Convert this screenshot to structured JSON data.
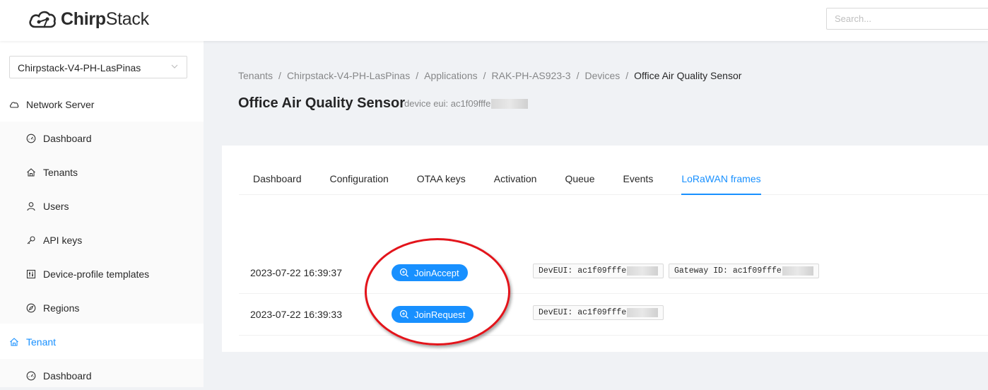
{
  "app": {
    "logo_bold": "Chirp",
    "logo_light": "Stack"
  },
  "search": {
    "placeholder": "Search..."
  },
  "sidebar": {
    "tenant_selector": "Chirpstack-V4-PH-LasPinas",
    "network_server": {
      "label": "Network Server",
      "items": [
        "Dashboard",
        "Tenants",
        "Users",
        "API keys",
        "Device-profile templates",
        "Regions"
      ]
    },
    "tenant": {
      "label": "Tenant",
      "items": [
        "Dashboard"
      ]
    }
  },
  "breadcrumb": [
    "Tenants",
    "Chirpstack-V4-PH-LasPinas",
    "Applications",
    "RAK-PH-AS923-3",
    "Devices",
    "Office Air Quality Sensor"
  ],
  "page": {
    "title": "Office Air Quality Sensor",
    "subtitle": "device eui: ac1f09fffe"
  },
  "tabs": [
    "Dashboard",
    "Configuration",
    "OTAA keys",
    "Activation",
    "Queue",
    "Events",
    "LoRaWAN frames"
  ],
  "active_tab": "LoRaWAN frames",
  "frames": [
    {
      "time": "2023-07-22 16:39:37",
      "type": "JoinAccept",
      "tags": [
        "DevEUI: ac1f09fffe",
        "Gateway ID: ac1f09fffe"
      ]
    },
    {
      "time": "2023-07-22 16:39:33",
      "type": "JoinRequest",
      "tags": [
        "DevEUI: ac1f09fffe"
      ]
    }
  ],
  "colors": {
    "accent": "#1890ff",
    "annotation": "#e3141b"
  }
}
